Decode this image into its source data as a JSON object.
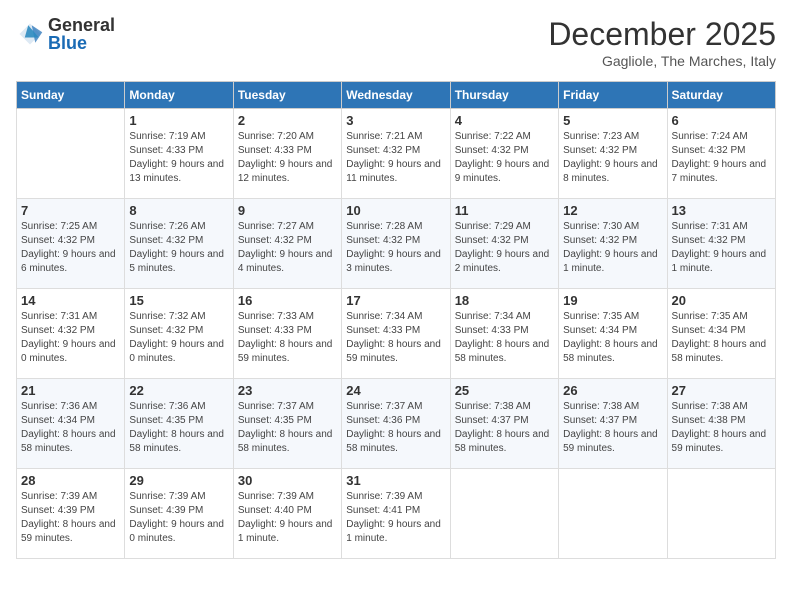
{
  "header": {
    "logo_general": "General",
    "logo_blue": "Blue",
    "month_title": "December 2025",
    "location": "Gagliole, The Marches, Italy"
  },
  "weekdays": [
    "Sunday",
    "Monday",
    "Tuesday",
    "Wednesday",
    "Thursday",
    "Friday",
    "Saturday"
  ],
  "weeks": [
    [
      {
        "day": "",
        "sunrise": "",
        "sunset": "",
        "daylight": ""
      },
      {
        "day": "1",
        "sunrise": "Sunrise: 7:19 AM",
        "sunset": "Sunset: 4:33 PM",
        "daylight": "Daylight: 9 hours and 13 minutes."
      },
      {
        "day": "2",
        "sunrise": "Sunrise: 7:20 AM",
        "sunset": "Sunset: 4:33 PM",
        "daylight": "Daylight: 9 hours and 12 minutes."
      },
      {
        "day": "3",
        "sunrise": "Sunrise: 7:21 AM",
        "sunset": "Sunset: 4:32 PM",
        "daylight": "Daylight: 9 hours and 11 minutes."
      },
      {
        "day": "4",
        "sunrise": "Sunrise: 7:22 AM",
        "sunset": "Sunset: 4:32 PM",
        "daylight": "Daylight: 9 hours and 9 minutes."
      },
      {
        "day": "5",
        "sunrise": "Sunrise: 7:23 AM",
        "sunset": "Sunset: 4:32 PM",
        "daylight": "Daylight: 9 hours and 8 minutes."
      },
      {
        "day": "6",
        "sunrise": "Sunrise: 7:24 AM",
        "sunset": "Sunset: 4:32 PM",
        "daylight": "Daylight: 9 hours and 7 minutes."
      }
    ],
    [
      {
        "day": "7",
        "sunrise": "Sunrise: 7:25 AM",
        "sunset": "Sunset: 4:32 PM",
        "daylight": "Daylight: 9 hours and 6 minutes."
      },
      {
        "day": "8",
        "sunrise": "Sunrise: 7:26 AM",
        "sunset": "Sunset: 4:32 PM",
        "daylight": "Daylight: 9 hours and 5 minutes."
      },
      {
        "day": "9",
        "sunrise": "Sunrise: 7:27 AM",
        "sunset": "Sunset: 4:32 PM",
        "daylight": "Daylight: 9 hours and 4 minutes."
      },
      {
        "day": "10",
        "sunrise": "Sunrise: 7:28 AM",
        "sunset": "Sunset: 4:32 PM",
        "daylight": "Daylight: 9 hours and 3 minutes."
      },
      {
        "day": "11",
        "sunrise": "Sunrise: 7:29 AM",
        "sunset": "Sunset: 4:32 PM",
        "daylight": "Daylight: 9 hours and 2 minutes."
      },
      {
        "day": "12",
        "sunrise": "Sunrise: 7:30 AM",
        "sunset": "Sunset: 4:32 PM",
        "daylight": "Daylight: 9 hours and 1 minute."
      },
      {
        "day": "13",
        "sunrise": "Sunrise: 7:31 AM",
        "sunset": "Sunset: 4:32 PM",
        "daylight": "Daylight: 9 hours and 1 minute."
      }
    ],
    [
      {
        "day": "14",
        "sunrise": "Sunrise: 7:31 AM",
        "sunset": "Sunset: 4:32 PM",
        "daylight": "Daylight: 9 hours and 0 minutes."
      },
      {
        "day": "15",
        "sunrise": "Sunrise: 7:32 AM",
        "sunset": "Sunset: 4:32 PM",
        "daylight": "Daylight: 9 hours and 0 minutes."
      },
      {
        "day": "16",
        "sunrise": "Sunrise: 7:33 AM",
        "sunset": "Sunset: 4:33 PM",
        "daylight": "Daylight: 8 hours and 59 minutes."
      },
      {
        "day": "17",
        "sunrise": "Sunrise: 7:34 AM",
        "sunset": "Sunset: 4:33 PM",
        "daylight": "Daylight: 8 hours and 59 minutes."
      },
      {
        "day": "18",
        "sunrise": "Sunrise: 7:34 AM",
        "sunset": "Sunset: 4:33 PM",
        "daylight": "Daylight: 8 hours and 58 minutes."
      },
      {
        "day": "19",
        "sunrise": "Sunrise: 7:35 AM",
        "sunset": "Sunset: 4:34 PM",
        "daylight": "Daylight: 8 hours and 58 minutes."
      },
      {
        "day": "20",
        "sunrise": "Sunrise: 7:35 AM",
        "sunset": "Sunset: 4:34 PM",
        "daylight": "Daylight: 8 hours and 58 minutes."
      }
    ],
    [
      {
        "day": "21",
        "sunrise": "Sunrise: 7:36 AM",
        "sunset": "Sunset: 4:34 PM",
        "daylight": "Daylight: 8 hours and 58 minutes."
      },
      {
        "day": "22",
        "sunrise": "Sunrise: 7:36 AM",
        "sunset": "Sunset: 4:35 PM",
        "daylight": "Daylight: 8 hours and 58 minutes."
      },
      {
        "day": "23",
        "sunrise": "Sunrise: 7:37 AM",
        "sunset": "Sunset: 4:35 PM",
        "daylight": "Daylight: 8 hours and 58 minutes."
      },
      {
        "day": "24",
        "sunrise": "Sunrise: 7:37 AM",
        "sunset": "Sunset: 4:36 PM",
        "daylight": "Daylight: 8 hours and 58 minutes."
      },
      {
        "day": "25",
        "sunrise": "Sunrise: 7:38 AM",
        "sunset": "Sunset: 4:37 PM",
        "daylight": "Daylight: 8 hours and 58 minutes."
      },
      {
        "day": "26",
        "sunrise": "Sunrise: 7:38 AM",
        "sunset": "Sunset: 4:37 PM",
        "daylight": "Daylight: 8 hours and 59 minutes."
      },
      {
        "day": "27",
        "sunrise": "Sunrise: 7:38 AM",
        "sunset": "Sunset: 4:38 PM",
        "daylight": "Daylight: 8 hours and 59 minutes."
      }
    ],
    [
      {
        "day": "28",
        "sunrise": "Sunrise: 7:39 AM",
        "sunset": "Sunset: 4:39 PM",
        "daylight": "Daylight: 8 hours and 59 minutes."
      },
      {
        "day": "29",
        "sunrise": "Sunrise: 7:39 AM",
        "sunset": "Sunset: 4:39 PM",
        "daylight": "Daylight: 9 hours and 0 minutes."
      },
      {
        "day": "30",
        "sunrise": "Sunrise: 7:39 AM",
        "sunset": "Sunset: 4:40 PM",
        "daylight": "Daylight: 9 hours and 1 minute."
      },
      {
        "day": "31",
        "sunrise": "Sunrise: 7:39 AM",
        "sunset": "Sunset: 4:41 PM",
        "daylight": "Daylight: 9 hours and 1 minute."
      },
      {
        "day": "",
        "sunrise": "",
        "sunset": "",
        "daylight": ""
      },
      {
        "day": "",
        "sunrise": "",
        "sunset": "",
        "daylight": ""
      },
      {
        "day": "",
        "sunrise": "",
        "sunset": "",
        "daylight": ""
      }
    ]
  ]
}
